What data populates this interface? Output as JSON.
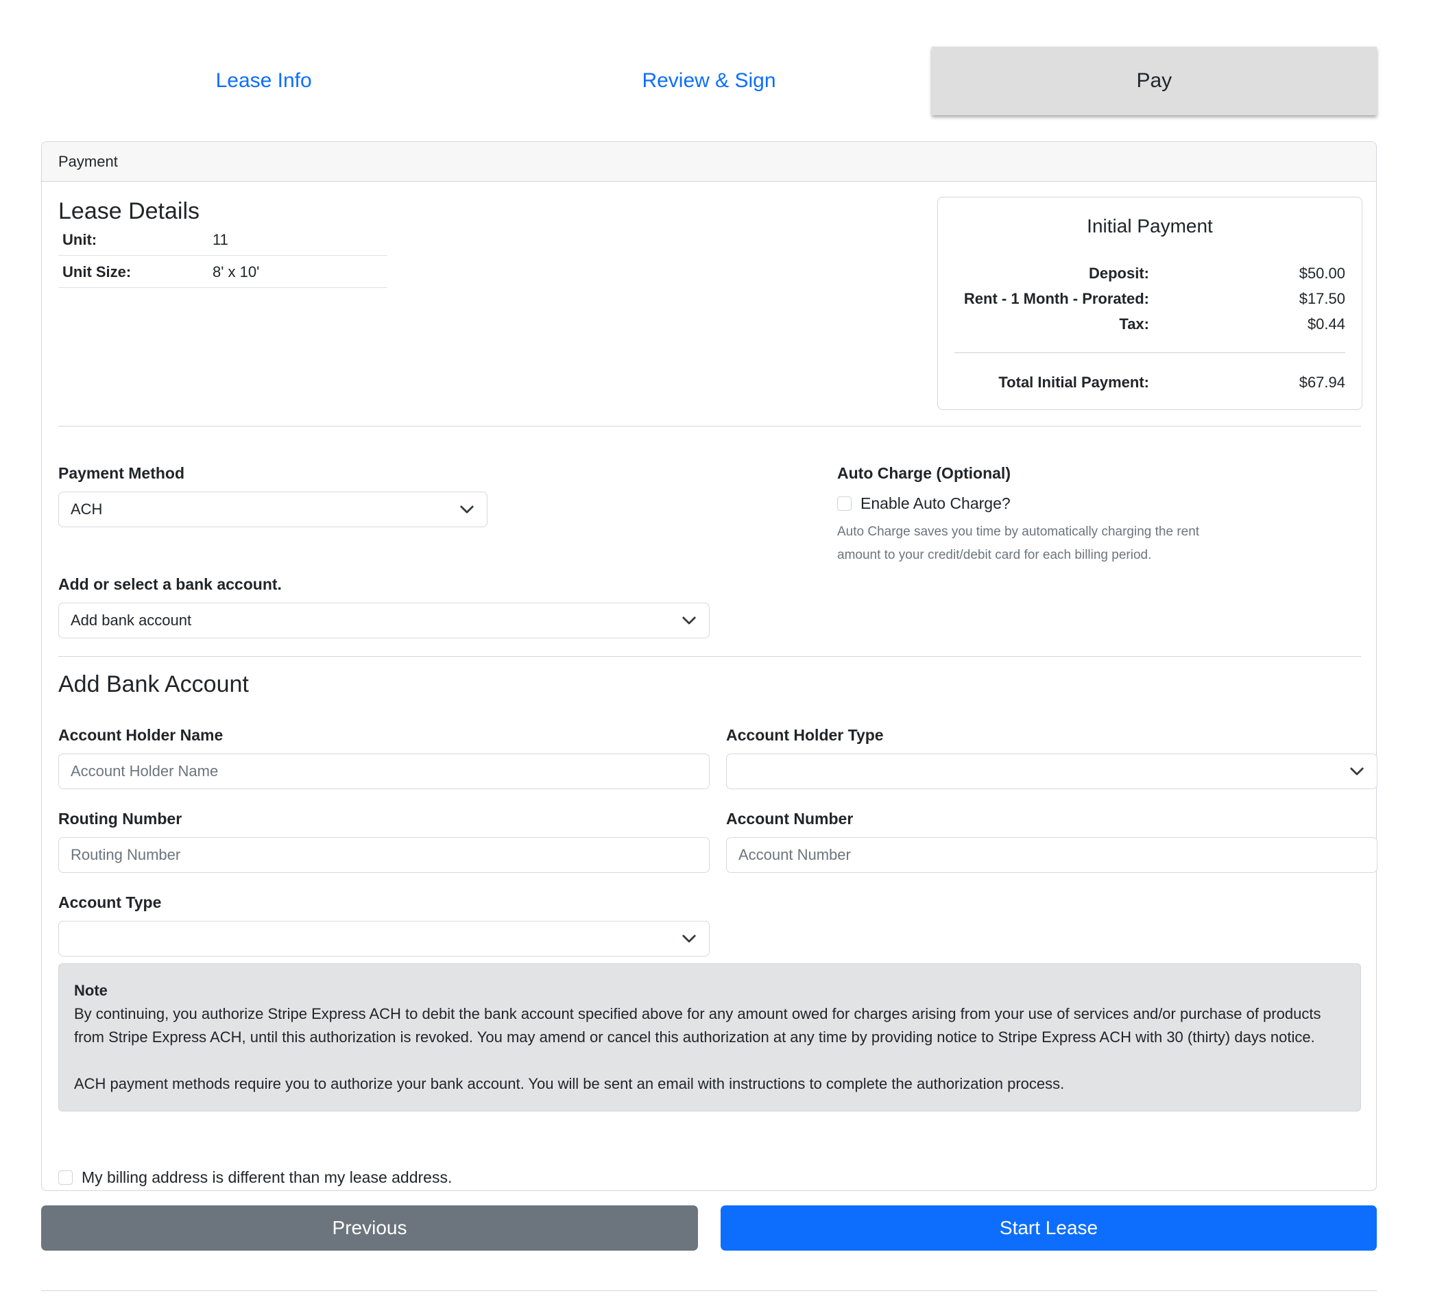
{
  "tabs": [
    {
      "label": "Lease Info",
      "active": false
    },
    {
      "label": "Review & Sign",
      "active": false
    },
    {
      "label": "Pay",
      "active": true
    }
  ],
  "card": {
    "header": "Payment"
  },
  "lease_details": {
    "title": "Lease Details",
    "rows": [
      {
        "label": "Unit:",
        "value": "11"
      },
      {
        "label": "Unit Size:",
        "value": "8' x 10'"
      }
    ]
  },
  "initial_payment": {
    "title": "Initial Payment",
    "rows": [
      {
        "label": "Deposit:",
        "value": "$50.00"
      },
      {
        "label": "Rent - 1 Month - Prorated:",
        "value": "$17.50"
      },
      {
        "label": "Tax:",
        "value": "$0.44"
      }
    ],
    "total_label": "Total Initial Payment:",
    "total_value": "$67.94"
  },
  "payment_method": {
    "label": "Payment Method",
    "value": "ACH"
  },
  "auto_charge": {
    "label": "Auto Charge (Optional)",
    "checkbox_label": "Enable Auto Charge?",
    "help_line1": "Auto Charge saves you time by automatically charging the rent",
    "help_line2": "amount to your credit/debit card for each billing period."
  },
  "bank_select": {
    "label": "Add or select a bank account.",
    "value": "Add bank account"
  },
  "add_bank": {
    "title": "Add Bank Account",
    "holder_name_label": "Account Holder Name",
    "holder_name_placeholder": "Account Holder Name",
    "holder_type_label": "Account Holder Type",
    "routing_label": "Routing Number",
    "routing_placeholder": "Routing Number",
    "account_number_label": "Account Number",
    "account_number_placeholder": "Account Number",
    "account_type_label": "Account Type"
  },
  "note": {
    "title": "Note",
    "p1": "By continuing, you authorize Stripe Express ACH to debit the bank account specified above for any amount owed for charges arising from your use of services and/or purchase of products from Stripe Express ACH, until this authorization is revoked. You may amend or cancel this authorization at any time by providing notice to Stripe Express ACH with 30 (thirty) days notice.",
    "p2": "ACH payment methods require you to authorize your bank account. You will be sent an email with instructions to complete the authorization process."
  },
  "billing_checkbox_label": "My billing address is different than my lease address.",
  "buttons": {
    "previous": "Previous",
    "start": "Start Lease"
  },
  "colors": {
    "primary": "#0d6efd",
    "secondary": "#6c757d",
    "active_tab": "#dedede",
    "note_bg": "#e2e3e5"
  }
}
